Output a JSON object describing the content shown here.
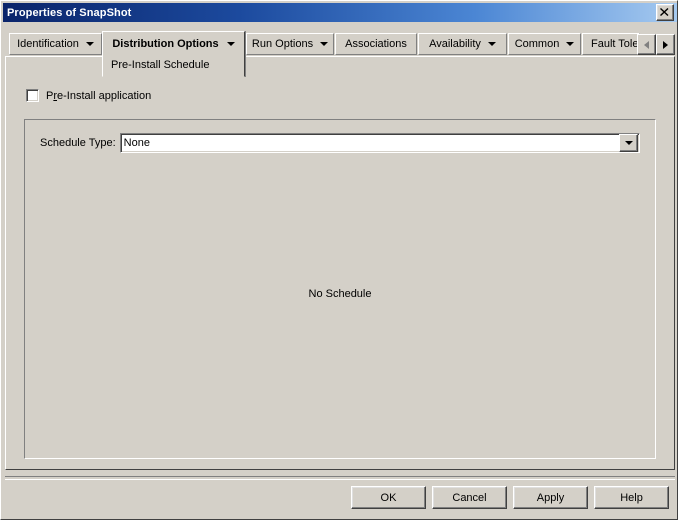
{
  "window": {
    "title": "Properties of SnapShot",
    "close_icon": "close-icon"
  },
  "tabs": [
    {
      "label": "Identification",
      "has_dropdown": true,
      "active": false,
      "sub_label": ""
    },
    {
      "label": "Distribution Options",
      "has_dropdown": true,
      "active": true,
      "sub_label": "Pre-Install Schedule"
    },
    {
      "label": "Run Options",
      "has_dropdown": true,
      "active": false,
      "sub_label": ""
    },
    {
      "label": "Associations",
      "has_dropdown": false,
      "active": false,
      "sub_label": ""
    },
    {
      "label": "Availability",
      "has_dropdown": true,
      "active": false,
      "sub_label": ""
    },
    {
      "label": "Common",
      "has_dropdown": true,
      "active": false,
      "sub_label": ""
    },
    {
      "label": "Fault Toleran",
      "has_dropdown": false,
      "active": false,
      "sub_label": ""
    }
  ],
  "tab_scroll": {
    "left_arrow": "scroll-left-icon",
    "right_arrow": "scroll-right-icon"
  },
  "content": {
    "preinstall_checkbox": {
      "label_before": "P",
      "label_accel": "r",
      "label_after": "e-Install application",
      "checked": false
    },
    "schedule_type_label": "Schedule Type:",
    "schedule_type_value": "None",
    "schedule_type_options": [
      "None"
    ],
    "empty_state_text": "No Schedule"
  },
  "buttons": [
    {
      "label": "OK"
    },
    {
      "label": "Cancel"
    },
    {
      "label": "Apply"
    },
    {
      "label": "Help"
    }
  ],
  "colors": {
    "face": "#d4d0c8",
    "title_start": "#0a246a",
    "title_end": "#a6caf0",
    "field_bg": "#ffffff",
    "text": "#000000"
  }
}
